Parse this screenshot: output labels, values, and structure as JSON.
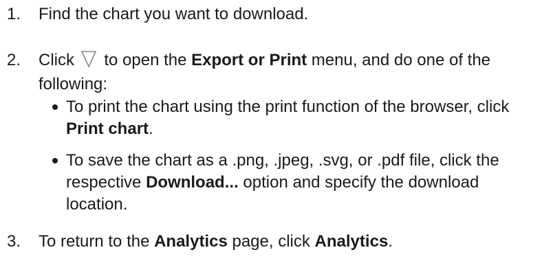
{
  "steps": [
    {
      "number": "1.",
      "text": "Find the chart you want to download."
    },
    {
      "number": "2.",
      "click": "Click",
      "open_pre": " to open the ",
      "menu_name": "Export or Print",
      "open_post": " menu, and do one of the following:",
      "icon": "export-menu-triangle-icon",
      "bullets": [
        {
          "pre": "To print the chart using the print function of the browser, click ",
          "bold": "Print chart",
          "post": "."
        },
        {
          "pre": "To save the chart as a .png, .jpeg, .svg, or .pdf file, click the respective ",
          "bold": "Download...",
          "post": " option and specify the download location."
        }
      ]
    },
    {
      "number": "3.",
      "pre": "To return to the ",
      "bold1": "Analytics",
      "mid": " page, click ",
      "bold2": "Analytics",
      "post": "."
    }
  ]
}
